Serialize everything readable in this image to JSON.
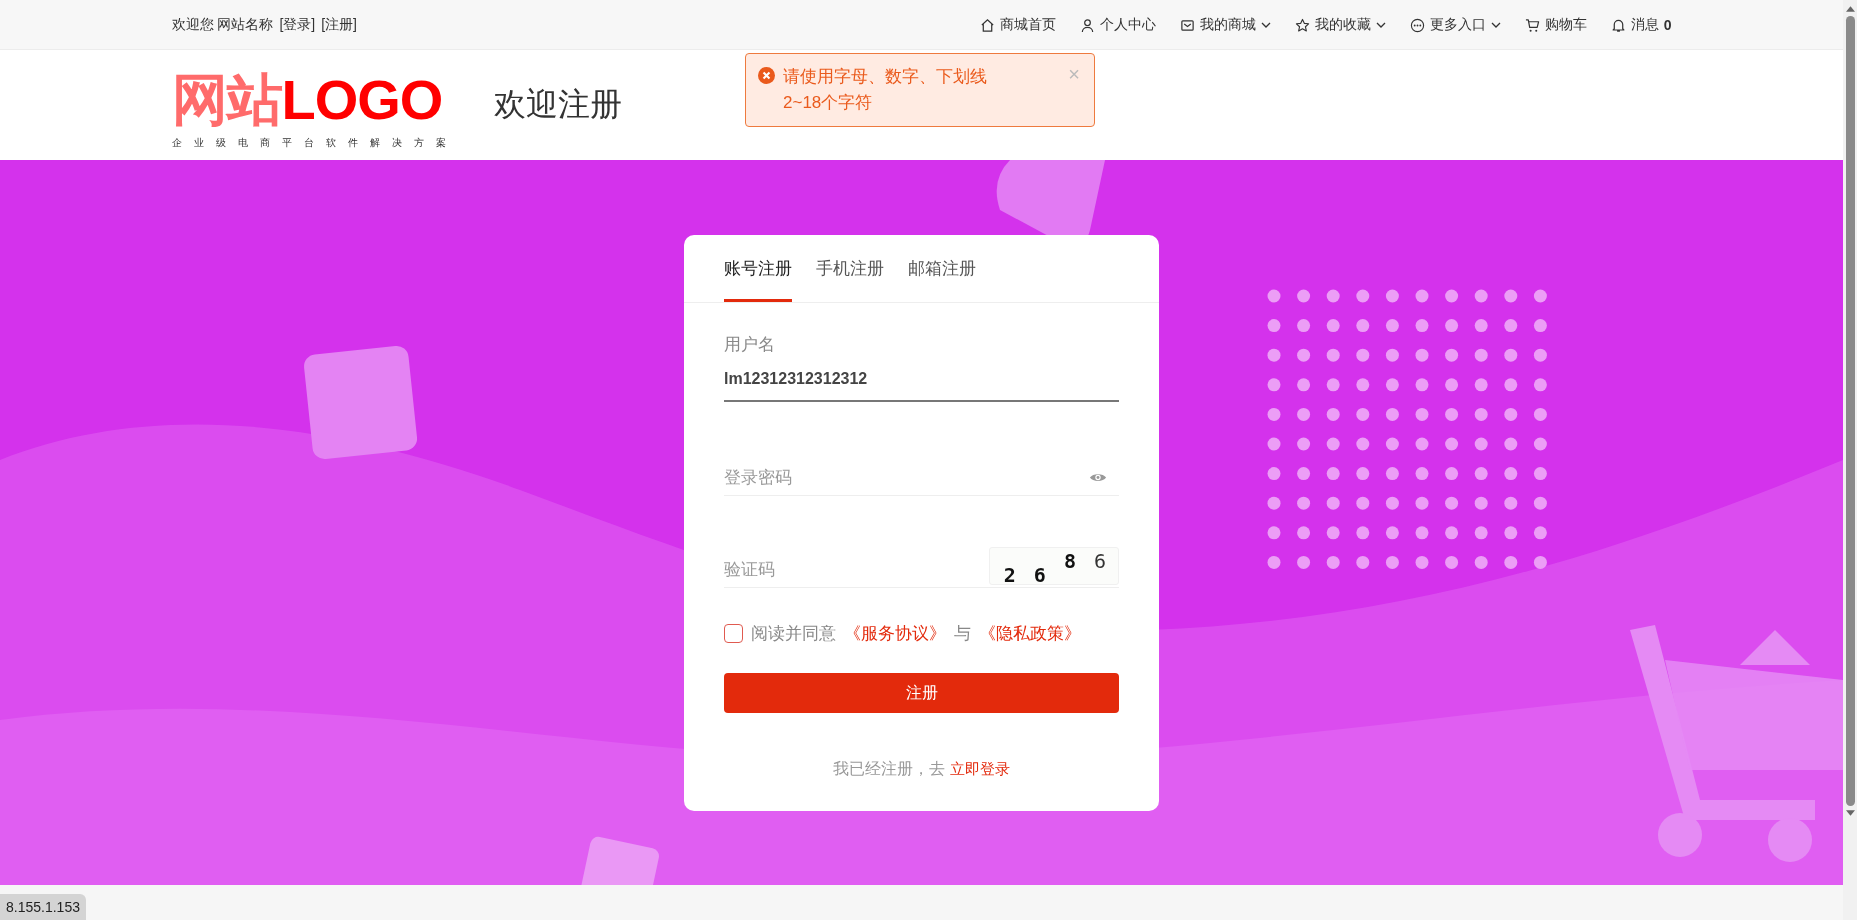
{
  "top_bar": {
    "welcome": "欢迎您 网站名称",
    "login_link": "[登录]",
    "register_link": "[注册]",
    "nav": [
      {
        "kind": "home",
        "label": "商城首页",
        "dropdown": false
      },
      {
        "kind": "user",
        "label": "个人中心",
        "dropdown": false
      },
      {
        "kind": "mail",
        "label": "我的商城",
        "dropdown": true
      },
      {
        "kind": "star",
        "label": "我的收藏",
        "dropdown": true
      },
      {
        "kind": "more",
        "label": "更多入口",
        "dropdown": true
      },
      {
        "kind": "cart",
        "label": "购物车",
        "dropdown": false
      },
      {
        "kind": "bell",
        "label": "消息",
        "badge": "0",
        "dropdown": false
      }
    ]
  },
  "header": {
    "logo_cn": "网站",
    "logo_en": "LOGO",
    "tagline": "企业级电商平台软件解决方案",
    "title": "欢迎注册"
  },
  "toast": {
    "message": "请使用字母、数字、下划线2~18个字符",
    "close": "×"
  },
  "form": {
    "tabs": [
      {
        "label": "账号注册",
        "selected": true
      },
      {
        "label": "手机注册",
        "selected": false
      },
      {
        "label": "邮箱注册",
        "selected": false
      }
    ],
    "fields": [
      {
        "kind": "text",
        "label": "用户名",
        "value": "lm12312312312312"
      },
      {
        "kind": "password",
        "placeholder": "登录密码"
      },
      {
        "kind": "captcha",
        "placeholder": "验证码",
        "captcha_chars": [
          "2",
          "6",
          "8",
          "6"
        ]
      }
    ],
    "agreement": {
      "checked": false,
      "prefix": "阅读并同意",
      "link1": "《服务协议》",
      "joiner": "与",
      "link2": "《隐私政策》"
    },
    "submit": "注册",
    "footer_text": "我已经注册，去",
    "footer_link": "立即登录"
  },
  "status_url": "8.155.1.153"
}
